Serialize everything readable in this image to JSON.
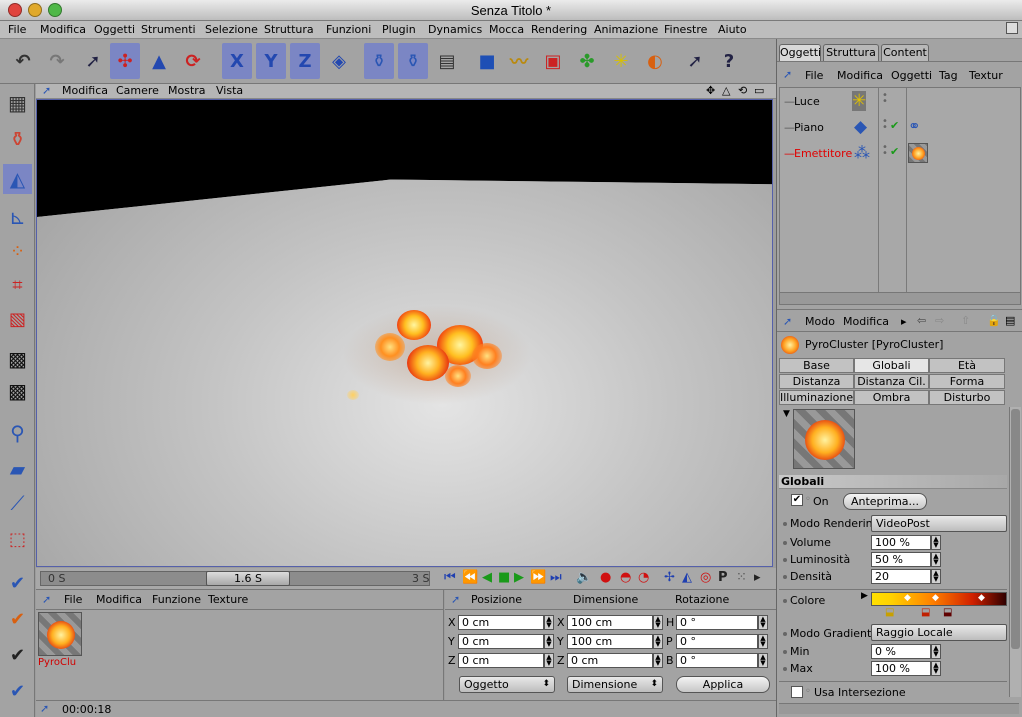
{
  "window": {
    "title": "Senza Titolo *"
  },
  "menu": [
    "File",
    "Modifica",
    "Oggetti",
    "Strumenti",
    "Selezione",
    "Struttura",
    "Funzioni",
    "Plugin",
    "Dynamics",
    "Mocca",
    "Rendering",
    "Animazione",
    "Finestre",
    "Aiuto"
  ],
  "toolbar": {
    "axis_x": "X",
    "axis_y": "Y",
    "axis_z": "Z"
  },
  "viewport": {
    "menu": [
      "Modifica",
      "Camere",
      "Mostra",
      "Vista"
    ]
  },
  "timeline": {
    "start": "0 S",
    "current": "1.6 S",
    "end": "3 S"
  },
  "material_manager": {
    "menu": [
      "File",
      "Modifica",
      "Funzione",
      "Texture"
    ],
    "material_name": "PyroClu"
  },
  "coords": {
    "headers": [
      "Posizione",
      "Dimensione",
      "Rotazione"
    ],
    "pos": [
      {
        "axis": "X",
        "value": "0 cm"
      },
      {
        "axis": "Y",
        "value": "0 cm"
      },
      {
        "axis": "Z",
        "value": "0 cm"
      }
    ],
    "size": [
      {
        "axis": "X",
        "value": "100 cm"
      },
      {
        "axis": "Y",
        "value": "100 cm"
      },
      {
        "axis": "Z",
        "value": "0 cm"
      }
    ],
    "rot": [
      {
        "axis": "H",
        "value": "0 °"
      },
      {
        "axis": "P",
        "value": "0 °"
      },
      {
        "axis": "B",
        "value": "0 °"
      }
    ],
    "mode1": "Oggetto",
    "mode2": "Dimensione",
    "apply": "Applica"
  },
  "status": {
    "time": "00:00:18"
  },
  "objects_panel": {
    "tabs": [
      "Oggetti",
      "Struttura",
      "Content"
    ],
    "menu": [
      "File",
      "Modifica",
      "Oggetti",
      "Tag",
      "Textur"
    ],
    "items": [
      {
        "name": "Luce"
      },
      {
        "name": "Piano"
      },
      {
        "name": "Emettitore"
      }
    ],
    "highlight_color": "#e00000"
  },
  "attributes": {
    "menu": [
      "Modo",
      "Modifica"
    ],
    "title": "PyroCluster [PyroCluster]",
    "tabs": [
      "Base",
      "Globali",
      "Età",
      "Distanza",
      "Distanza Cil.",
      "Forma",
      "Illuminazione",
      "Ombra",
      "Disturbo"
    ],
    "section": "Globali",
    "on_label": "On",
    "preview_button": "Anteprima...",
    "fields": [
      {
        "label": "Modo Rendering",
        "value": "VideoPost"
      },
      {
        "label": "Volume",
        "value": "100 %"
      },
      {
        "label": "Luminosità",
        "value": "50 %"
      },
      {
        "label": "Densità",
        "value": "20"
      },
      {
        "label": "Colore",
        "value": ""
      },
      {
        "label": "Modo Gradiente",
        "value": "Raggio Locale"
      },
      {
        "label": "Min",
        "value": "0 %"
      },
      {
        "label": "Max",
        "value": "100 %"
      }
    ],
    "use_intersection": "Usa Intersezione"
  }
}
